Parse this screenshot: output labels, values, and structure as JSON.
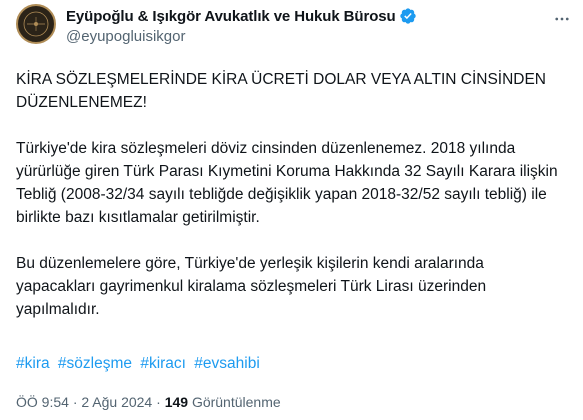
{
  "tweet": {
    "author": {
      "name": "Eyüpoğlu & Işıkgör Avukatlık ve Hukuk Bürosu",
      "handle": "@eyupogluisikgor",
      "verified_color": "#1d9bf0",
      "avatar_bg": "#2b2318",
      "avatar_ring": "#b08d57"
    },
    "paragraphs": [
      "KİRA SÖZLEŞMELERİNDE KİRA ÜCRETİ DOLAR VEYA ALTIN CİNSİNDEN DÜZENLENEMEZ!",
      "Türkiye'de kira sözleşmeleri döviz cinsinden düzenlenemez. 2018 yılında yürürlüğe giren Türk Parası Kıymetini Koruma Hakkında 32 Sayılı Karara ilişkin Tebliğ (2008-32/34 sayılı tebliğde değişiklik yapan 2018-32/52 sayılı tebliğ) ile birlikte bazı kısıtlamalar getirilmiştir.",
      "Bu düzenlemelere göre, Türkiye'de yerleşik kişilerin kendi aralarında yapacakları gayrimenkul kiralama sözleşmeleri Türk Lirası üzerinden yapılmalıdır."
    ],
    "hashtags": [
      "#kira",
      "#sözleşme",
      "#kiracı",
      "#evsahibi"
    ],
    "meta": {
      "time": "ÖÖ 9:54",
      "separator": "·",
      "date": "2 Ağu 2024",
      "views_count": "149",
      "views_label": "Görüntülenme"
    },
    "link_color": "#1d9bf0"
  }
}
